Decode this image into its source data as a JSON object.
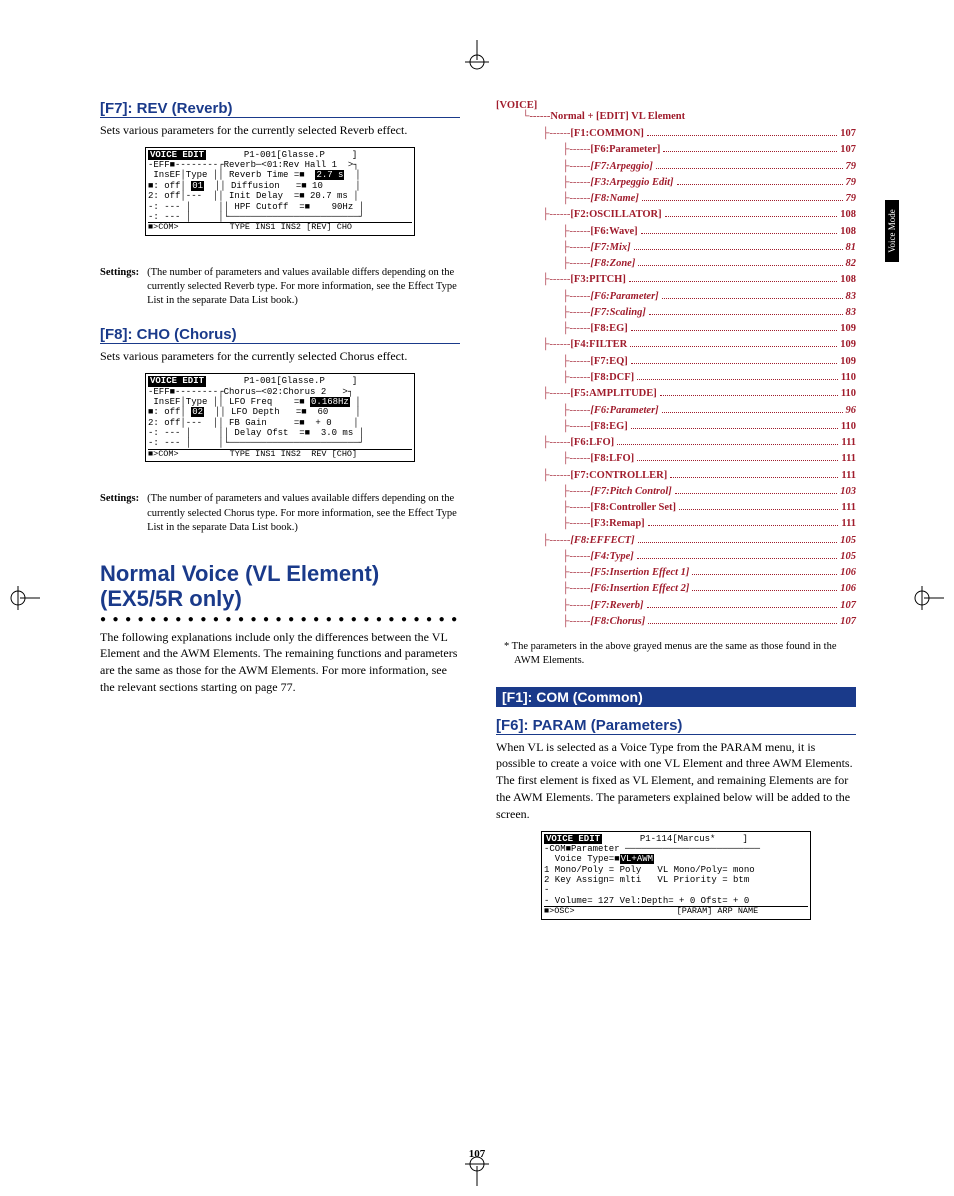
{
  "sideTab": "Voice Mode",
  "pageNumber": "107",
  "left": {
    "rev": {
      "title": "[F7]: REV (Reverb)",
      "para": "Sets various parameters for the currently selected Reverb effect.",
      "lcd": {
        "header": "VOICE EDIT",
        "headerRight": "P1-001[Glasse.P     ]",
        "r1": "-EFF■--------┌Reverb─<01:Rev Hall 1  >┐",
        "r2": " InsEF│Type ││ Reverb Time =■  2.7 s  │",
        "r2hl": "2.7 s",
        "r3": "1: off│ 01  ││ Diffusion   =■ 10      │",
        "r3hl": "01",
        "r4": "2: off│---  ││ Init Delay  =■ 20.7 ms │",
        "r5": "-: --- │     ││ HPF Cutoff  =■    90Hz │",
        "r6": "-: --- │     │└────────────────────────┘",
        "bottom": "■>COM>          TYPE INS1 INS2 [REV] CHO"
      },
      "settingsLabel": "Settings:",
      "settings": "(The number of parameters and values available differs depending on the currently selected Reverb type. For more information, see the Effect Type List in the separate Data List book.)"
    },
    "cho": {
      "title": "[F8]: CHO (Chorus)",
      "para": "Sets various parameters for the currently selected Chorus effect.",
      "lcd": {
        "header": "VOICE EDIT",
        "headerRight": "P1-001[Glasse.P     ]",
        "r1": "-EFF■--------┌Chorus─<02:Chorus 2   >┐",
        "r2": " InsEF│Type ││ LFO Freq    =■ 0.168Hz │",
        "r2hl": "0.168Hz",
        "r3": "1: off│ 02  ││ LFO Depth   =■  60     │",
        "r3hl": "02",
        "r4": "2: off│---  ││ FB Gain     =■  + 0    │",
        "r5": "-: --- │     ││ Delay Ofst  =■  3.0 ms │",
        "r6": "-: --- │     │└────────────────────────┘",
        "bottom": "■>COM>          TYPE INS1 INS2  REV [CHO]"
      },
      "settingsLabel": "Settings:",
      "settings": "(The number of parameters and values available differs depending on the currently selected Chorus type. For more information, see the Effect Type List in the separate Data List book.)"
    },
    "bigTitle1": "Normal Voice (VL Element)",
    "bigTitle2": "(EX5/5R only)",
    "bigPara": "The following explanations include only the differences between the VL Element and the AWM Elements. The remaining functions and parameters are the same as those for the AWM Elements. For more information, see the relevant sections starting on page 77."
  },
  "right": {
    "treeRoot": "[VOICE]",
    "treeSub": "Normal + [EDIT]   VL Element",
    "entries": [
      {
        "lvl": 1,
        "label": "[F1:COMMON]",
        "pg": "107",
        "it": false
      },
      {
        "lvl": 2,
        "label": "[F6:Parameter]",
        "pg": "107",
        "it": false
      },
      {
        "lvl": 2,
        "label": "[F7:Arpeggio]",
        "pg": "79",
        "it": true
      },
      {
        "lvl": 2,
        "label": "[F3:Arpeggio Edit]",
        "pg": "79",
        "it": true
      },
      {
        "lvl": 2,
        "label": "[F8:Name]",
        "pg": "79",
        "it": true
      },
      {
        "lvl": 1,
        "label": "[F2:OSCILLATOR]",
        "pg": "108",
        "it": false
      },
      {
        "lvl": 2,
        "label": "[F6:Wave]",
        "pg": "108",
        "it": false
      },
      {
        "lvl": 2,
        "label": "[F7:Mix]",
        "pg": "81",
        "it": true
      },
      {
        "lvl": 2,
        "label": "[F8:Zone]",
        "pg": "82",
        "it": true
      },
      {
        "lvl": 1,
        "label": "[F3:PITCH]",
        "pg": "108",
        "it": false
      },
      {
        "lvl": 2,
        "label": "[F6:Parameter]",
        "pg": "83",
        "it": true
      },
      {
        "lvl": 2,
        "label": "[F7:Scaling]",
        "pg": "83",
        "it": true
      },
      {
        "lvl": 2,
        "label": "[F8:EG]",
        "pg": "109",
        "it": false
      },
      {
        "lvl": 1,
        "label": "[F4:FILTER",
        "pg": "109",
        "it": false
      },
      {
        "lvl": 2,
        "label": "[F7:EQ]",
        "pg": "109",
        "it": false
      },
      {
        "lvl": 2,
        "label": "[F8:DCF]",
        "pg": "110",
        "it": false
      },
      {
        "lvl": 1,
        "label": "[F5:AMPLITUDE]",
        "pg": "110",
        "it": false
      },
      {
        "lvl": 2,
        "label": "[F6:Parameter]",
        "pg": "96",
        "it": true
      },
      {
        "lvl": 2,
        "label": "[F8:EG]",
        "pg": "110",
        "it": false
      },
      {
        "lvl": 1,
        "label": "[F6:LFO]",
        "pg": "111",
        "it": false
      },
      {
        "lvl": 2,
        "label": "[F8:LFO]",
        "pg": "111",
        "it": false
      },
      {
        "lvl": 1,
        "label": "[F7:CONTROLLER]",
        "pg": "111",
        "it": false
      },
      {
        "lvl": 2,
        "label": "[F7:Pitch Control]",
        "pg": "103",
        "it": true
      },
      {
        "lvl": 2,
        "label": "[F8:Controller Set]",
        "pg": "111",
        "it": false
      },
      {
        "lvl": 2,
        "label": "[F3:Remap]",
        "pg": "111",
        "it": false
      },
      {
        "lvl": 1,
        "label": "[F8:EFFECT]",
        "pg": "105",
        "it": true
      },
      {
        "lvl": 2,
        "label": "[F4:Type]",
        "pg": "105",
        "it": true
      },
      {
        "lvl": 2,
        "label": "[F5:Insertion Effect 1]",
        "pg": "106",
        "it": true
      },
      {
        "lvl": 2,
        "label": "[F6:Insertion Effect 2]",
        "pg": "106",
        "it": true
      },
      {
        "lvl": 2,
        "label": "[F7:Reverb]",
        "pg": "107",
        "it": true
      },
      {
        "lvl": 2,
        "label": "[F8:Chorus]",
        "pg": "107",
        "it": true
      }
    ],
    "note": "*   The parameters in the above grayed menus are the same as those found in the AWM Elements.",
    "sectionBar": "[F1]: COM (Common)",
    "paramTitle": "[F6]: PARAM (Parameters)",
    "paramPara": "When VL is selected as a Voice Type from the PARAM menu, it is possible to create a voice with one VL Element and three AWM Elements. The first element is fixed as VL Element, and remaining Elements are for the AWM Elements. The parameters explained below will be added to the screen.",
    "lcd": {
      "header": "VOICE EDIT",
      "headerRight": "P1-114[Marcus*     ]",
      "r1": "-COM■Parameter ─────────────────────────",
      "r2": "  Voice Type=■VL+AWM",
      "r2hl": "VL+AWM",
      "r3": "1 Mono/Poly = Poly   VL Mono/Poly= mono",
      "r4": "2 Key Assign= mlti   VL Priority = btm",
      "r5": "-",
      "r6": "- Volume= 127 Vel:Depth= + 0 Ofst= + 0",
      "bottom": "■>OSC>                    [PARAM] ARP NAME"
    }
  }
}
